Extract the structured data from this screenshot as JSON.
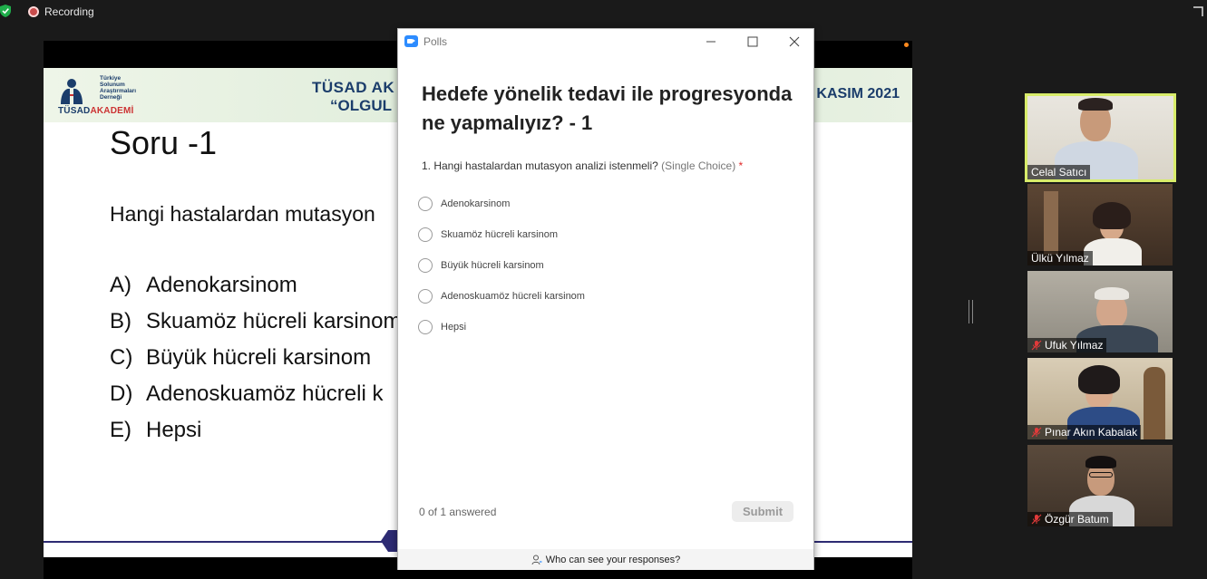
{
  "status": {
    "recording_label": "Recording"
  },
  "slide": {
    "banner_title_line1": "TÜSAD AK",
    "banner_title_line2": "“OLGUL",
    "banner_date": "KASIM 2021",
    "logo_lines": "Türkiye Solunum Araştırmaları Derneği",
    "logo_word_a": "TÜSAD",
    "logo_word_b": "AKADEMİ",
    "soru_title": "Soru -1",
    "question_text": "Hangi hastalardan mutasyon",
    "options": [
      {
        "letter": "A)",
        "text": "Adenokarsinom"
      },
      {
        "letter": "B)",
        "text": "Skuamöz hücreli karsinom"
      },
      {
        "letter": "C)",
        "text": "Büyük hücreli karsinom"
      },
      {
        "letter": "D)",
        "text": "Adenoskuamöz hücreli k"
      },
      {
        "letter": "E)",
        "text": "Hepsi"
      }
    ]
  },
  "polls": {
    "window_title": "Polls",
    "heading": "Hedefe yönelik tedavi ile progresyonda  ne yapmalıyız? - 1",
    "question": {
      "number_text": "1. Hangi hastalardan mutasyon analizi istenmeli?",
      "type_text": "(Single Choice)",
      "required_mark": "*"
    },
    "choices": [
      " Adenokarsinom",
      "Skuamöz hücreli karsinom",
      "Büyük hücreli karsinom",
      "Adenoskuamöz hücreli karsinom",
      "Hepsi"
    ],
    "answered_text": "0 of 1 answered",
    "submit_label": "Submit",
    "who_can_see": "Who can see your responses?"
  },
  "participants": [
    {
      "name": "Celal Satıcı",
      "muted": false,
      "active": true
    },
    {
      "name": "Ülkü Yılmaz",
      "muted": false,
      "active": false
    },
    {
      "name": "Ufuk Yılmaz",
      "muted": true,
      "active": false
    },
    {
      "name": "Pınar Akın Kabalak",
      "muted": true,
      "active": false
    },
    {
      "name": "Özgür Batum",
      "muted": true,
      "active": false
    }
  ],
  "colors": {
    "brand_navy": "#1b3d6b",
    "zoom_blue": "#2d8cff",
    "active_speaker": "#d8ec6a",
    "required_red": "#e02828"
  }
}
